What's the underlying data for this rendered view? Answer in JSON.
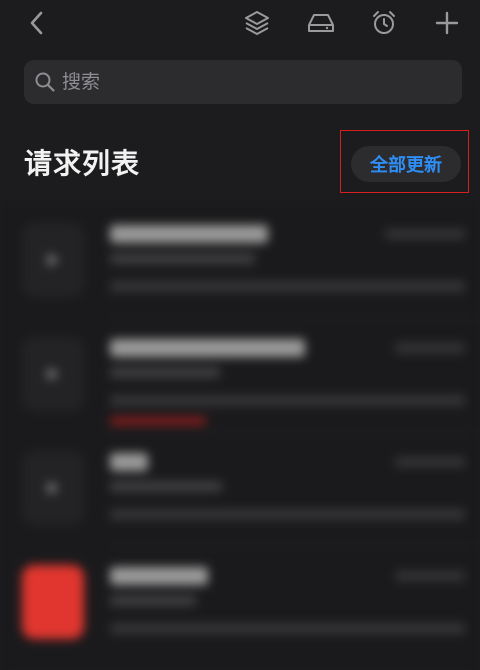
{
  "toolbar": {
    "back_icon": "chevron-left-icon",
    "layers_icon": "layers-icon",
    "storage_icon": "drive-icon",
    "alarm_icon": "alarm-clock-icon",
    "add_icon": "plus-icon"
  },
  "search": {
    "placeholder": "搜索",
    "icon": "search-icon"
  },
  "section": {
    "title": "请求列表",
    "update_all_label": "全部更新"
  },
  "colors": {
    "background": "#1c1c1e",
    "accent": "#2f8ef5",
    "highlight": "#d61f1f"
  }
}
